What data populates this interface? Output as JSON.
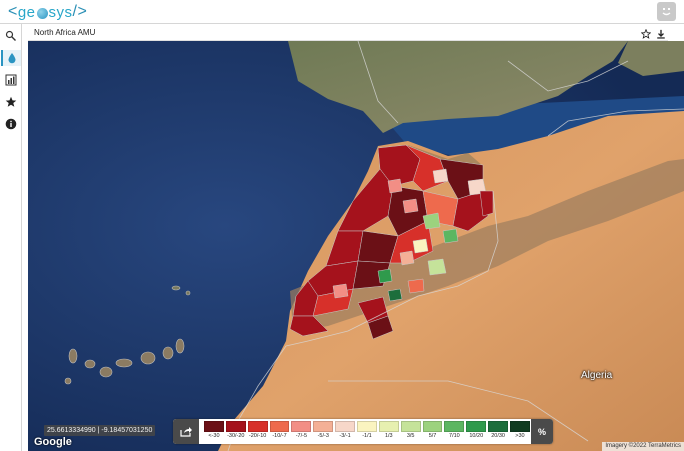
{
  "app": {
    "logo_left": "<",
    "logo_text_a": "ge",
    "logo_text_b": "sys",
    "logo_right": "/>"
  },
  "sidebar": {
    "items": [
      {
        "name": "layers-tool-icon"
      },
      {
        "name": "droplet-icon"
      },
      {
        "name": "chart-icon"
      },
      {
        "name": "star-icon"
      },
      {
        "name": "info-icon"
      }
    ]
  },
  "panel": {
    "title": "North Africa AMU"
  },
  "map": {
    "coordinates": "25.6613334990 | -9.18457031250",
    "google_label": "Google",
    "attribution": "Imagery ©2022 TerraMetrics",
    "place_label": "Algeria"
  },
  "legend": {
    "unit_button": "%",
    "items": [
      {
        "label": "<-30",
        "color": "#6b1016"
      },
      {
        "label": "-30/-20",
        "color": "#a5121c"
      },
      {
        "label": "-20/-10",
        "color": "#d7302a"
      },
      {
        "label": "-10/-7",
        "color": "#ee6a4d"
      },
      {
        "label": "-7/-5",
        "color": "#f28e85"
      },
      {
        "label": "-5/-3",
        "color": "#f4b096"
      },
      {
        "label": "-3/-1",
        "color": "#f7d7c9"
      },
      {
        "label": "-1/1",
        "color": "#faf4c0"
      },
      {
        "label": "1/3",
        "color": "#e7f0b0"
      },
      {
        "label": "3/5",
        "color": "#c5e39a"
      },
      {
        "label": "5/7",
        "color": "#9cd27e"
      },
      {
        "label": "7/10",
        "color": "#5cb661"
      },
      {
        "label": "10/20",
        "color": "#2f9a4c"
      },
      {
        "label": "20/30",
        "color": "#1d6e3c"
      },
      {
        "label": ">30",
        "color": "#103b20"
      }
    ]
  }
}
